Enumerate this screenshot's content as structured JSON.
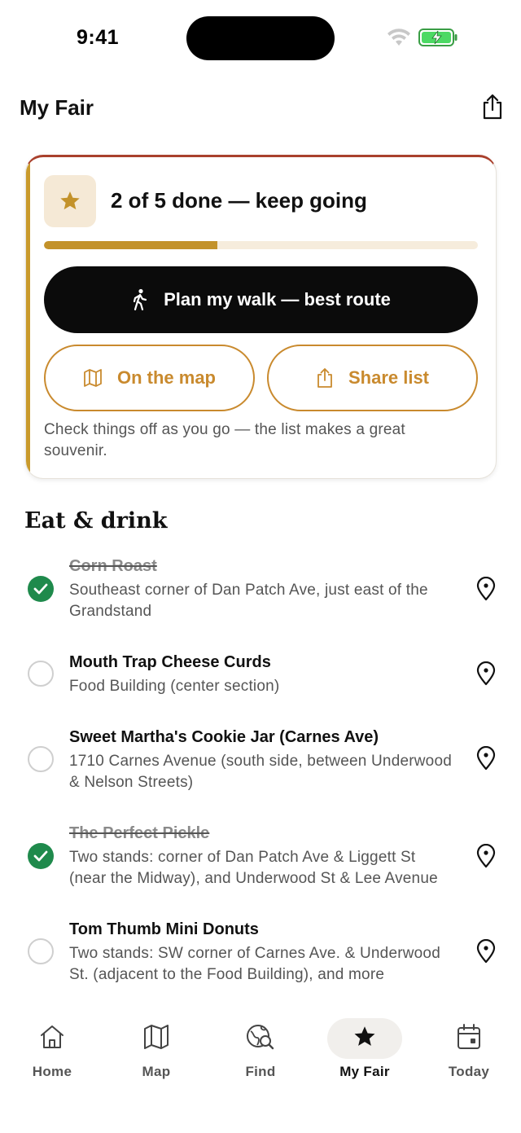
{
  "status": {
    "time": "9:41"
  },
  "header": {
    "title": "My Fair",
    "share_icon": "share-icon"
  },
  "progress": {
    "text": "2 of 5 done — keep going",
    "done": 2,
    "total": 5,
    "plan_label": "Plan my walk — best route",
    "map_label": "On the map",
    "share_label": "Share list",
    "note": "Check things off as you go — the list makes a great souvenir.",
    "accent_color": "#c99a2b",
    "brand_color": "#a9402c"
  },
  "section": {
    "title": "Eat & drink"
  },
  "items": [
    {
      "name": "Corn Roast",
      "done": true,
      "desc": "Southeast corner of Dan Patch Ave, just east of the Grandstand"
    },
    {
      "name": "Mouth Trap Cheese Curds",
      "done": false,
      "desc": "Food Building (center section)"
    },
    {
      "name": "Sweet Martha's Cookie Jar (Carnes Ave)",
      "done": false,
      "desc": "1710 Carnes Avenue (south side, between Underwood & Nelson Streets)"
    },
    {
      "name": "The Perfect Pickle",
      "done": true,
      "desc": "Two stands: corner of Dan Patch Ave & Liggett St (near the Midway), and Underwood St & Lee Avenue"
    },
    {
      "name": "Tom Thumb Mini Donuts",
      "done": false,
      "desc": "Two stands: SW corner of Carnes Ave. & Underwood St. (adjacent to the Food Building), and more"
    }
  ],
  "tabs": [
    {
      "label": "Home",
      "icon": "home-icon"
    },
    {
      "label": "Map",
      "icon": "map-icon"
    },
    {
      "label": "Find",
      "icon": "find-icon"
    },
    {
      "label": "My Fair",
      "icon": "star-icon",
      "active": true
    },
    {
      "label": "Today",
      "icon": "calendar-icon"
    }
  ],
  "colors": {
    "check_green": "#1f8a4c",
    "outline_orange": "#c98a2e",
    "progress_fill": "#c3922a"
  }
}
